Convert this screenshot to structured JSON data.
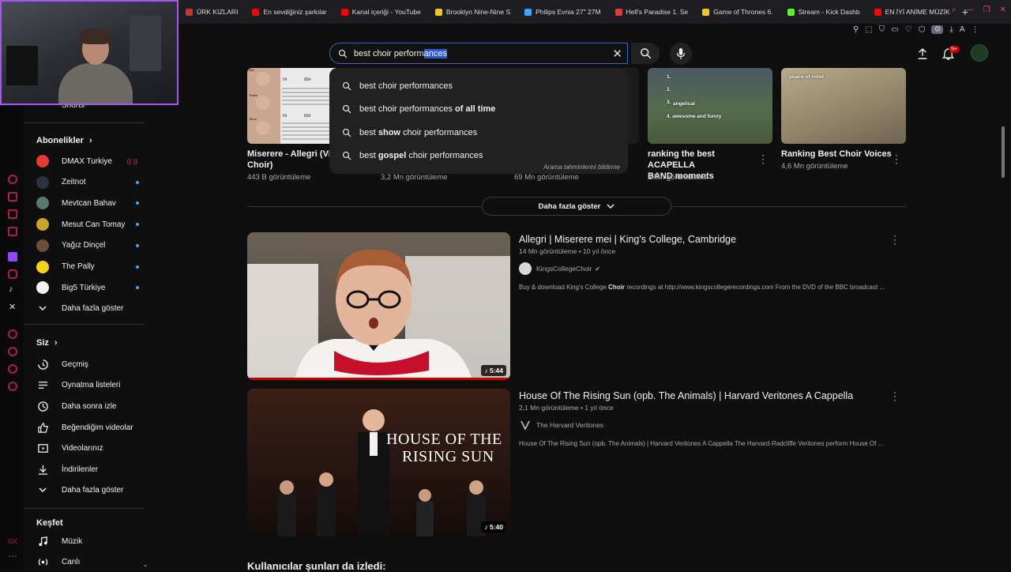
{
  "browser": {
    "tabs": [
      {
        "label": "ÜRK KIZLARI",
        "color": "#c0392b"
      },
      {
        "label": "En sevdiğiniz şarkılar",
        "color": "#ff0000"
      },
      {
        "label": "Kanal içeriği - YouTube",
        "color": "#ff0000"
      },
      {
        "label": "Brooklyn Nine-Nine S",
        "color": "#f5c518"
      },
      {
        "label": "Philips Evnia 27\" 27M",
        "color": "#3ea6ff"
      },
      {
        "label": "Hell's Paradise 1. Se",
        "color": "#e53935"
      },
      {
        "label": "Game of Thrones 6.",
        "color": "#f5c518"
      },
      {
        "label": "Stream - Kick Dashb",
        "color": "#53fc18"
      },
      {
        "label": "EN İYİ ANİME MÜZİK",
        "color": "#ff0000"
      }
    ],
    "new_tab": "+"
  },
  "search": {
    "query_start": "best choir perform",
    "query_selected": "ances"
  },
  "header": {
    "notif_count": "9+",
    "colors": {
      "accent": "#3ea6ff",
      "live": "#cc0000",
      "search_border": "#3a67c4"
    }
  },
  "suggestions": {
    "items": [
      {
        "prefix": "best choir performances",
        "bold": "",
        "suffix": ""
      },
      {
        "prefix": "best choir performances",
        "bold": " of all time",
        "suffix": ""
      },
      {
        "prefix": "best ",
        "bold": "show",
        "suffix": " choir performances"
      },
      {
        "prefix": "best ",
        "bold": "gospel",
        "suffix": " choir performances"
      }
    ],
    "footer": "Arama tahminlerini bildirme"
  },
  "sidebar": {
    "shorts_label": "Shorts",
    "subs_header": "Abonelikler",
    "subs": [
      {
        "label": "DMAX Turkiye",
        "color": "#e53935",
        "live": true
      },
      {
        "label": "Zeitnot",
        "color": "#2b3340",
        "live": false
      },
      {
        "label": "Mevtcan Bahav",
        "color": "#577a6a",
        "live": false
      },
      {
        "label": "Mesut Can Tomay",
        "color": "#c9a227",
        "live": false
      },
      {
        "label": "Yağız Dinçel",
        "color": "#6b4f3a",
        "live": false
      },
      {
        "label": "The Pally",
        "color": "#f5d31d",
        "live": false
      },
      {
        "label": "Big5 Türkiye",
        "color": "#f1f1f1",
        "live": false
      }
    ],
    "subs_more": "Daha fazla göster",
    "you_header": "Siz",
    "you": [
      {
        "label": "Geçmiş",
        "icon": "history-icon"
      },
      {
        "label": "Oynatma listeleri",
        "icon": "playlist-icon"
      },
      {
        "label": "Daha sonra izle",
        "icon": "clock-icon"
      },
      {
        "label": "Beğendiğim videolar",
        "icon": "thumbs-up-icon"
      },
      {
        "label": "Videolarınız",
        "icon": "video-icon"
      },
      {
        "label": "İndirilenler",
        "icon": "download-icon"
      }
    ],
    "you_more": "Daha fazla göster",
    "explore_header": "Keşfet",
    "explore": [
      {
        "label": "Müzik",
        "icon": "music-icon"
      },
      {
        "label": "Canlı",
        "icon": "live-icon"
      }
    ]
  },
  "shorts": [
    {
      "title_line1": "Miserere - Allegri (Virt",
      "title_line2": "Choir)",
      "views": "443 B görüntüleme"
    },
    {
      "title_line1": "",
      "title_line2": "",
      "views": "3,2 Mn görüntüleme"
    },
    {
      "title_line1": "",
      "title_line2": "",
      "views": "69 Mn görüntüleme"
    },
    {
      "title_line1": "ranking the best ACAPELLA",
      "title_line2": "BAND moments",
      "views": "2 Mn görüntüleme"
    },
    {
      "title_line1": "Ranking Best Choir Voices",
      "title_line2": "",
      "views": "4,6 Mn görüntüleme"
    }
  ],
  "shorts_thumb_text": {
    "s4_lines": [
      "1.",
      "2.",
      "3.",
      "angelical",
      "4. awesome and funny"
    ],
    "s5_text": "peace of mind",
    "s1_labels": [
      "re",
      "me",
      "re",
      "me",
      "Alto",
      "Treble",
      "Tenor"
    ]
  },
  "show_more": "Daha fazla göster",
  "videos": [
    {
      "title": "Allegri | Miserere mei | King's College, Cambridge",
      "meta": "14 Mn görüntüleme • 10 yıl önce",
      "channel": "KingsCollegeChoir",
      "verified": true,
      "desc_start": "Buy & download King's College ",
      "desc_bold": "Choir",
      "desc_end": " recordings at http://www.kingscollegerecordings.com From the DVD of the BBC broadcast ...",
      "duration": "5:44"
    },
    {
      "title": "House Of The Rising Sun (opb. The Animals) | Harvard Veritones A Cappella",
      "meta": "2,1 Mn görüntüleme • 1 yıl önce",
      "channel": "The Harvard Veritones",
      "verified": false,
      "desc_start": "House Of The Rising Sun (opb. The Animals) | Harvard Veritones A Cappella The Harvard-Radcliffe Veritones perform House Of ...",
      "desc_bold": "",
      "desc_end": "",
      "duration": "5:40",
      "thumb_text_1": "HOUSE OF THE",
      "thumb_text_2": "RISING SUN"
    }
  ],
  "section_title": "Kullanıcılar şunları da izledi:"
}
